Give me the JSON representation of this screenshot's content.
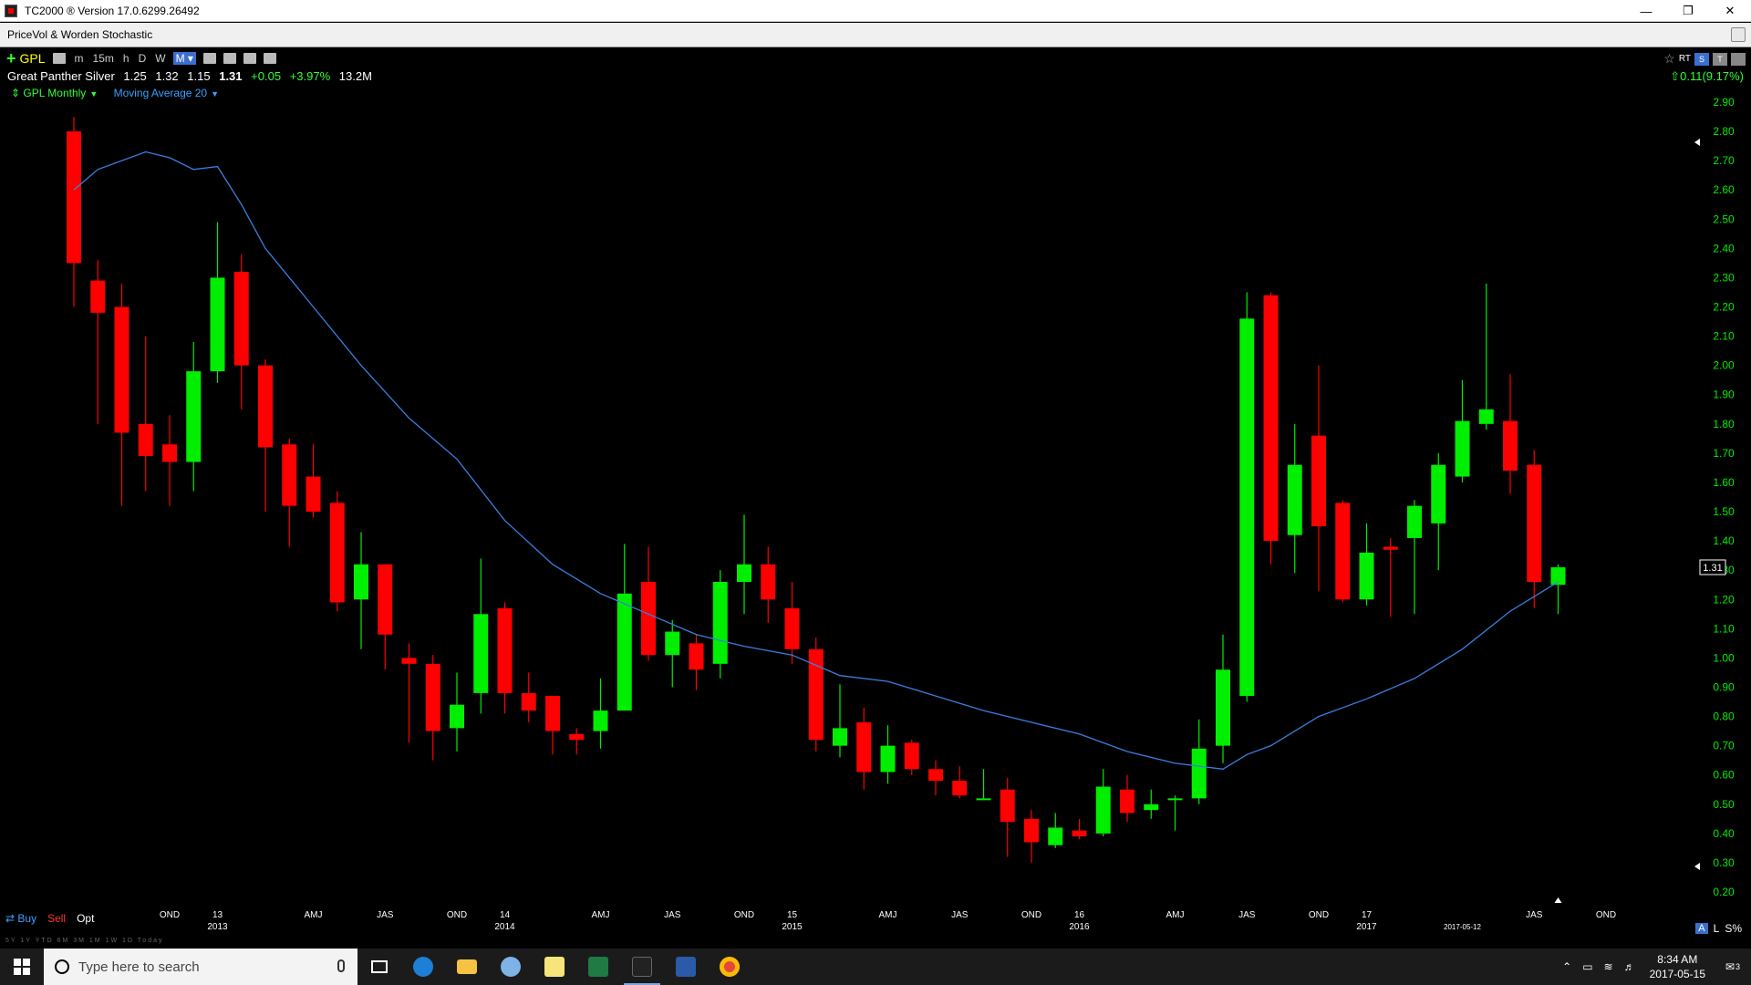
{
  "window": {
    "title": "TC2000 ® Version 17.0.6299.26492",
    "subtitle": "PriceVol & Worden Stochastic"
  },
  "toolbar": {
    "symbol": "GPL",
    "timeframes": [
      "m",
      "15m",
      "h",
      "D",
      "W"
    ],
    "selected_timeframe": "M",
    "right_badges": [
      "RT",
      "S",
      "T"
    ]
  },
  "quote": {
    "name": "Great Panther Silver",
    "open": "1.25",
    "high": "1.32",
    "low": "1.15",
    "last": "1.31",
    "change": "+0.05",
    "change_pct": "+3.97%",
    "volume": "13.2M",
    "right_change": "0.11(9.17%)"
  },
  "legend": {
    "symbol_label": "GPL Monthly",
    "indicator_label": "Moving Average 20"
  },
  "trading": {
    "buy": "Buy",
    "sell": "Sell",
    "opt": "Opt"
  },
  "bottom_right": {
    "a": "A",
    "l": "L",
    "s": "S%"
  },
  "periods_strip": "5Y 1Y YTD 6M 3M 1M 1W 1D Today",
  "taskbar": {
    "search_placeholder": "Type here to search",
    "time": "8:34 AM",
    "date": "2017-05-15",
    "notifications": "3"
  },
  "colors": {
    "up": "#00ee00",
    "down": "#ff0000",
    "ma": "#3a7fe0",
    "axis_text": "#00ee00",
    "background": "#000000"
  },
  "chart_data": {
    "type": "candlestick",
    "symbol": "GPL",
    "interval": "Monthly",
    "ylim": [
      0.2,
      2.95
    ],
    "y_ticks": [
      "2.90",
      "2.80",
      "2.70",
      "2.60",
      "2.50",
      "2.40",
      "2.30",
      "2.20",
      "2.10",
      "2.00",
      "1.90",
      "1.80",
      "1.70",
      "1.60",
      "1.50",
      "1.40",
      "1.30",
      "1.20",
      "1.10",
      "1.00",
      "0.90",
      "0.80",
      "0.70",
      "0.60",
      "0.50",
      "0.40",
      "0.30",
      "0.20"
    ],
    "last_price_label": "1.31",
    "x_axis_labels": [
      {
        "month": "2012-11",
        "top": "OND",
        "bottom": ""
      },
      {
        "month": "2013-01",
        "top": "13",
        "bottom": "2013"
      },
      {
        "month": "2013-05",
        "top": "AMJ",
        "bottom": ""
      },
      {
        "month": "2013-08",
        "top": "JAS",
        "bottom": ""
      },
      {
        "month": "2013-11",
        "top": "OND",
        "bottom": ""
      },
      {
        "month": "2014-01",
        "top": "14",
        "bottom": "2014"
      },
      {
        "month": "2014-05",
        "top": "AMJ",
        "bottom": ""
      },
      {
        "month": "2014-08",
        "top": "JAS",
        "bottom": ""
      },
      {
        "month": "2014-11",
        "top": "OND",
        "bottom": ""
      },
      {
        "month": "2015-01",
        "top": "15",
        "bottom": "2015"
      },
      {
        "month": "2015-05",
        "top": "AMJ",
        "bottom": ""
      },
      {
        "month": "2015-08",
        "top": "JAS",
        "bottom": ""
      },
      {
        "month": "2015-11",
        "top": "OND",
        "bottom": ""
      },
      {
        "month": "2016-01",
        "top": "16",
        "bottom": "2016"
      },
      {
        "month": "2016-05",
        "top": "AMJ",
        "bottom": ""
      },
      {
        "month": "2016-08",
        "top": "JAS",
        "bottom": ""
      },
      {
        "month": "2016-11",
        "top": "OND",
        "bottom": ""
      },
      {
        "month": "2017-01",
        "top": "17",
        "bottom": "2017"
      },
      {
        "month": "2017-05",
        "top": "",
        "bottom": "2017-05-12"
      },
      {
        "month": "2017-08",
        "top": "JAS",
        "bottom": ""
      },
      {
        "month": "2017-11",
        "top": "OND",
        "bottom": ""
      }
    ],
    "candles": [
      {
        "month": "2012-07",
        "o": 2.8,
        "h": 2.85,
        "l": 2.2,
        "c": 2.35
      },
      {
        "month": "2012-08",
        "o": 2.29,
        "h": 2.36,
        "l": 1.8,
        "c": 2.18
      },
      {
        "month": "2012-09",
        "o": 2.2,
        "h": 2.28,
        "l": 1.52,
        "c": 1.77
      },
      {
        "month": "2012-10",
        "o": 1.8,
        "h": 2.1,
        "l": 1.57,
        "c": 1.69
      },
      {
        "month": "2012-11",
        "o": 1.73,
        "h": 1.83,
        "l": 1.52,
        "c": 1.67
      },
      {
        "month": "2012-12",
        "o": 1.67,
        "h": 2.08,
        "l": 1.57,
        "c": 1.98
      },
      {
        "month": "2013-01",
        "o": 1.98,
        "h": 2.49,
        "l": 1.94,
        "c": 2.3
      },
      {
        "month": "2013-02",
        "o": 2.32,
        "h": 2.38,
        "l": 1.85,
        "c": 2.0
      },
      {
        "month": "2013-03",
        "o": 2.0,
        "h": 2.02,
        "l": 1.5,
        "c": 1.72
      },
      {
        "month": "2013-04",
        "o": 1.73,
        "h": 1.75,
        "l": 1.38,
        "c": 1.52
      },
      {
        "month": "2013-05",
        "o": 1.62,
        "h": 1.73,
        "l": 1.48,
        "c": 1.5
      },
      {
        "month": "2013-06",
        "o": 1.53,
        "h": 1.57,
        "l": 1.16,
        "c": 1.19
      },
      {
        "month": "2013-07",
        "o": 1.2,
        "h": 1.43,
        "l": 1.03,
        "c": 1.32
      },
      {
        "month": "2013-08",
        "o": 1.32,
        "h": 1.32,
        "l": 0.96,
        "c": 1.08
      },
      {
        "month": "2013-09",
        "o": 1.0,
        "h": 1.05,
        "l": 0.71,
        "c": 0.98
      },
      {
        "month": "2013-10",
        "o": 0.98,
        "h": 1.01,
        "l": 0.65,
        "c": 0.75
      },
      {
        "month": "2013-11",
        "o": 0.76,
        "h": 0.95,
        "l": 0.68,
        "c": 0.84
      },
      {
        "month": "2013-12",
        "o": 0.88,
        "h": 1.34,
        "l": 0.81,
        "c": 1.15
      },
      {
        "month": "2014-01",
        "o": 1.17,
        "h": 1.19,
        "l": 0.81,
        "c": 0.88
      },
      {
        "month": "2014-02",
        "o": 0.88,
        "h": 0.95,
        "l": 0.78,
        "c": 0.82
      },
      {
        "month": "2014-03",
        "o": 0.87,
        "h": 0.87,
        "l": 0.67,
        "c": 0.75
      },
      {
        "month": "2014-04",
        "o": 0.74,
        "h": 0.76,
        "l": 0.67,
        "c": 0.72
      },
      {
        "month": "2014-05",
        "o": 0.75,
        "h": 0.93,
        "l": 0.69,
        "c": 0.82
      },
      {
        "month": "2014-06",
        "o": 0.82,
        "h": 1.39,
        "l": 0.82,
        "c": 1.22
      },
      {
        "month": "2014-07",
        "o": 1.26,
        "h": 1.38,
        "l": 0.99,
        "c": 1.01
      },
      {
        "month": "2014-08",
        "o": 1.01,
        "h": 1.13,
        "l": 0.9,
        "c": 1.09
      },
      {
        "month": "2014-09",
        "o": 1.05,
        "h": 1.08,
        "l": 0.89,
        "c": 0.96
      },
      {
        "month": "2014-10",
        "o": 0.98,
        "h": 1.3,
        "l": 0.93,
        "c": 1.26
      },
      {
        "month": "2014-11",
        "o": 1.26,
        "h": 1.49,
        "l": 1.15,
        "c": 1.32
      },
      {
        "month": "2014-12",
        "o": 1.32,
        "h": 1.38,
        "l": 1.12,
        "c": 1.2
      },
      {
        "month": "2015-01",
        "o": 1.17,
        "h": 1.26,
        "l": 0.98,
        "c": 1.03
      },
      {
        "month": "2015-02",
        "o": 1.03,
        "h": 1.07,
        "l": 0.68,
        "c": 0.72
      },
      {
        "month": "2015-03",
        "o": 0.7,
        "h": 0.91,
        "l": 0.66,
        "c": 0.76
      },
      {
        "month": "2015-04",
        "o": 0.78,
        "h": 0.83,
        "l": 0.55,
        "c": 0.61
      },
      {
        "month": "2015-05",
        "o": 0.61,
        "h": 0.77,
        "l": 0.57,
        "c": 0.7
      },
      {
        "month": "2015-06",
        "o": 0.71,
        "h": 0.72,
        "l": 0.6,
        "c": 0.62
      },
      {
        "month": "2015-07",
        "o": 0.62,
        "h": 0.65,
        "l": 0.53,
        "c": 0.58
      },
      {
        "month": "2015-08",
        "o": 0.58,
        "h": 0.63,
        "l": 0.52,
        "c": 0.53
      },
      {
        "month": "2015-09",
        "o": 0.52,
        "h": 0.62,
        "l": 0.52,
        "c": 0.52
      },
      {
        "month": "2015-10",
        "o": 0.55,
        "h": 0.59,
        "l": 0.32,
        "c": 0.44
      },
      {
        "month": "2015-11",
        "o": 0.45,
        "h": 0.48,
        "l": 0.3,
        "c": 0.37
      },
      {
        "month": "2015-12",
        "o": 0.36,
        "h": 0.47,
        "l": 0.35,
        "c": 0.42
      },
      {
        "month": "2016-01",
        "o": 0.41,
        "h": 0.45,
        "l": 0.38,
        "c": 0.39
      },
      {
        "month": "2016-02",
        "o": 0.4,
        "h": 0.62,
        "l": 0.39,
        "c": 0.56
      },
      {
        "month": "2016-03",
        "o": 0.55,
        "h": 0.6,
        "l": 0.44,
        "c": 0.47
      },
      {
        "month": "2016-04",
        "o": 0.48,
        "h": 0.55,
        "l": 0.45,
        "c": 0.5
      },
      {
        "month": "2016-05",
        "o": 0.52,
        "h": 0.53,
        "l": 0.41,
        "c": 0.52
      },
      {
        "month": "2016-06",
        "o": 0.52,
        "h": 0.79,
        "l": 0.5,
        "c": 0.69
      },
      {
        "month": "2016-07",
        "o": 0.7,
        "h": 1.08,
        "l": 0.64,
        "c": 0.96
      },
      {
        "month": "2016-08",
        "o": 0.87,
        "h": 2.25,
        "l": 0.85,
        "c": 2.16
      },
      {
        "month": "2016-09",
        "o": 2.24,
        "h": 2.25,
        "l": 1.32,
        "c": 1.4
      },
      {
        "month": "2016-10",
        "o": 1.42,
        "h": 1.8,
        "l": 1.29,
        "c": 1.66
      },
      {
        "month": "2016-11",
        "o": 1.76,
        "h": 2.0,
        "l": 1.23,
        "c": 1.45
      },
      {
        "month": "2016-12",
        "o": 1.53,
        "h": 1.54,
        "l": 1.19,
        "c": 1.2
      },
      {
        "month": "2017-01",
        "o": 1.2,
        "h": 1.46,
        "l": 1.18,
        "c": 1.36
      },
      {
        "month": "2017-02",
        "o": 1.38,
        "h": 1.41,
        "l": 1.14,
        "c": 1.37
      },
      {
        "month": "2017-03",
        "o": 1.41,
        "h": 1.54,
        "l": 1.15,
        "c": 1.52
      },
      {
        "month": "2017-04",
        "o": 1.46,
        "h": 1.7,
        "l": 1.3,
        "c": 1.66
      },
      {
        "month": "2017-05",
        "o": 1.62,
        "h": 1.95,
        "l": 1.6,
        "c": 1.81
      },
      {
        "month": "2017-06",
        "o": 1.8,
        "h": 2.28,
        "l": 1.78,
        "c": 1.85
      },
      {
        "month": "2017-07",
        "o": 1.81,
        "h": 1.97,
        "l": 1.56,
        "c": 1.64
      },
      {
        "month": "2017-08",
        "o": 1.66,
        "h": 1.71,
        "l": 1.17,
        "c": 1.26
      },
      {
        "month": "2017-09",
        "o": 1.25,
        "h": 1.32,
        "l": 1.15,
        "c": 1.31
      }
    ],
    "moving_average": {
      "period": 20,
      "points": [
        {
          "month": "2012-07",
          "v": 2.6
        },
        {
          "month": "2012-08",
          "v": 2.67
        },
        {
          "month": "2012-10",
          "v": 2.73
        },
        {
          "month": "2012-11",
          "v": 2.71
        },
        {
          "month": "2012-12",
          "v": 2.67
        },
        {
          "month": "2013-01",
          "v": 2.68
        },
        {
          "month": "2013-02",
          "v": 2.55
        },
        {
          "month": "2013-03",
          "v": 2.4
        },
        {
          "month": "2013-04",
          "v": 2.3
        },
        {
          "month": "2013-05",
          "v": 2.2
        },
        {
          "month": "2013-07",
          "v": 2.0
        },
        {
          "month": "2013-09",
          "v": 1.82
        },
        {
          "month": "2013-11",
          "v": 1.68
        },
        {
          "month": "2014-01",
          "v": 1.47
        },
        {
          "month": "2014-03",
          "v": 1.32
        },
        {
          "month": "2014-05",
          "v": 1.22
        },
        {
          "month": "2014-07",
          "v": 1.15
        },
        {
          "month": "2014-09",
          "v": 1.08
        },
        {
          "month": "2014-11",
          "v": 1.04
        },
        {
          "month": "2015-01",
          "v": 1.01
        },
        {
          "month": "2015-03",
          "v": 0.94
        },
        {
          "month": "2015-05",
          "v": 0.92
        },
        {
          "month": "2015-07",
          "v": 0.87
        },
        {
          "month": "2015-09",
          "v": 0.82
        },
        {
          "month": "2015-11",
          "v": 0.78
        },
        {
          "month": "2016-01",
          "v": 0.74
        },
        {
          "month": "2016-03",
          "v": 0.68
        },
        {
          "month": "2016-05",
          "v": 0.64
        },
        {
          "month": "2016-07",
          "v": 0.62
        },
        {
          "month": "2016-08",
          "v": 0.67
        },
        {
          "month": "2016-09",
          "v": 0.7
        },
        {
          "month": "2016-10",
          "v": 0.75
        },
        {
          "month": "2016-11",
          "v": 0.8
        },
        {
          "month": "2017-01",
          "v": 0.86
        },
        {
          "month": "2017-03",
          "v": 0.93
        },
        {
          "month": "2017-05",
          "v": 1.03
        },
        {
          "month": "2017-07",
          "v": 1.16
        },
        {
          "month": "2017-08",
          "v": 1.21
        },
        {
          "month": "2017-09",
          "v": 1.26
        }
      ]
    }
  }
}
